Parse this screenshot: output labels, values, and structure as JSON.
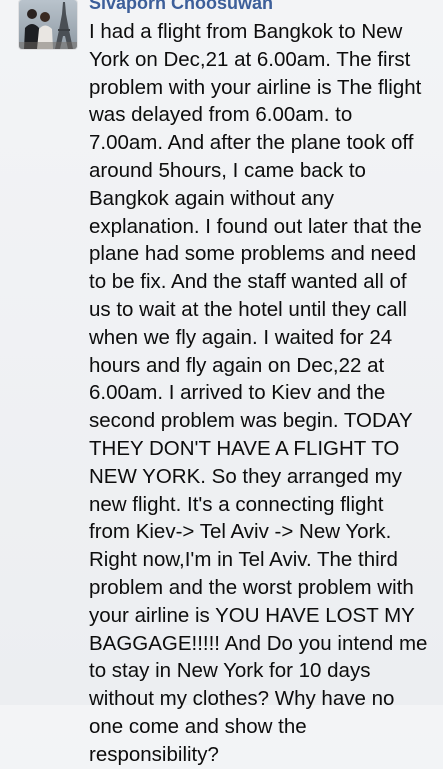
{
  "post": {
    "author": "Sivaporn Choosuwan",
    "avatar_icon": "profile-photo-eiffel-tower",
    "message_lines": [
      "I had a flight from Bangkok to New",
      "York on Dec,21 at 6.00am. The first",
      "problem with your airline is The flight",
      "was delayed from 6.00am. to",
      "7.00am. And after the plane took off",
      "around 5hours, I came back to",
      "Bangkok again without any",
      "explanation. I found out later that the",
      "plane had some problems and need",
      "to be fix. And the staff wanted all of",
      "us to wait at the hotel until they call",
      "when we fly again. I waited for 24",
      "hours and fly again on Dec,22 at",
      "6.00am. I arrived to Kiev and the",
      "second problem was begin. TODAY",
      "THEY DON'T HAVE A FLIGHT TO",
      "NEW YORK. So they arranged my",
      "new flight. It's a connecting flight",
      "from Kiev-> Tel Aviv -> New York.",
      "Right now,I'm in Tel Aviv. The third",
      "problem and the worst problem with",
      "your airline is YOU HAVE LOST MY",
      "BAGGAGE!!!!! And Do you intend me",
      "to stay in New York for 10 days",
      "without my clothes? Why have no",
      "one come and show the",
      "responsibility?"
    ],
    "colors": {
      "author": "#3d5f9a",
      "text": "#0d0d0d",
      "background": "#f0f1f3"
    }
  }
}
